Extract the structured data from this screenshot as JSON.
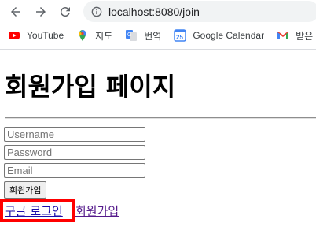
{
  "browser": {
    "url": "localhost:8080/join",
    "bookmarks": [
      {
        "label": "YouTube",
        "icon": "youtube-icon"
      },
      {
        "label": "지도",
        "icon": "maps-icon"
      },
      {
        "label": "번역",
        "icon": "translate-icon"
      },
      {
        "label": "Google Calendar",
        "icon": "calendar-icon"
      },
      {
        "label": "받은",
        "icon": "gmail-icon"
      }
    ]
  },
  "page": {
    "title": "회원가입 페이지",
    "form": {
      "username_placeholder": "Username",
      "password_placeholder": "Password",
      "email_placeholder": "Email",
      "submit_label": "회원가입"
    },
    "links": {
      "google_login": "구글 로그인",
      "join": "회원가입"
    },
    "highlight_color": "#ff0000"
  }
}
